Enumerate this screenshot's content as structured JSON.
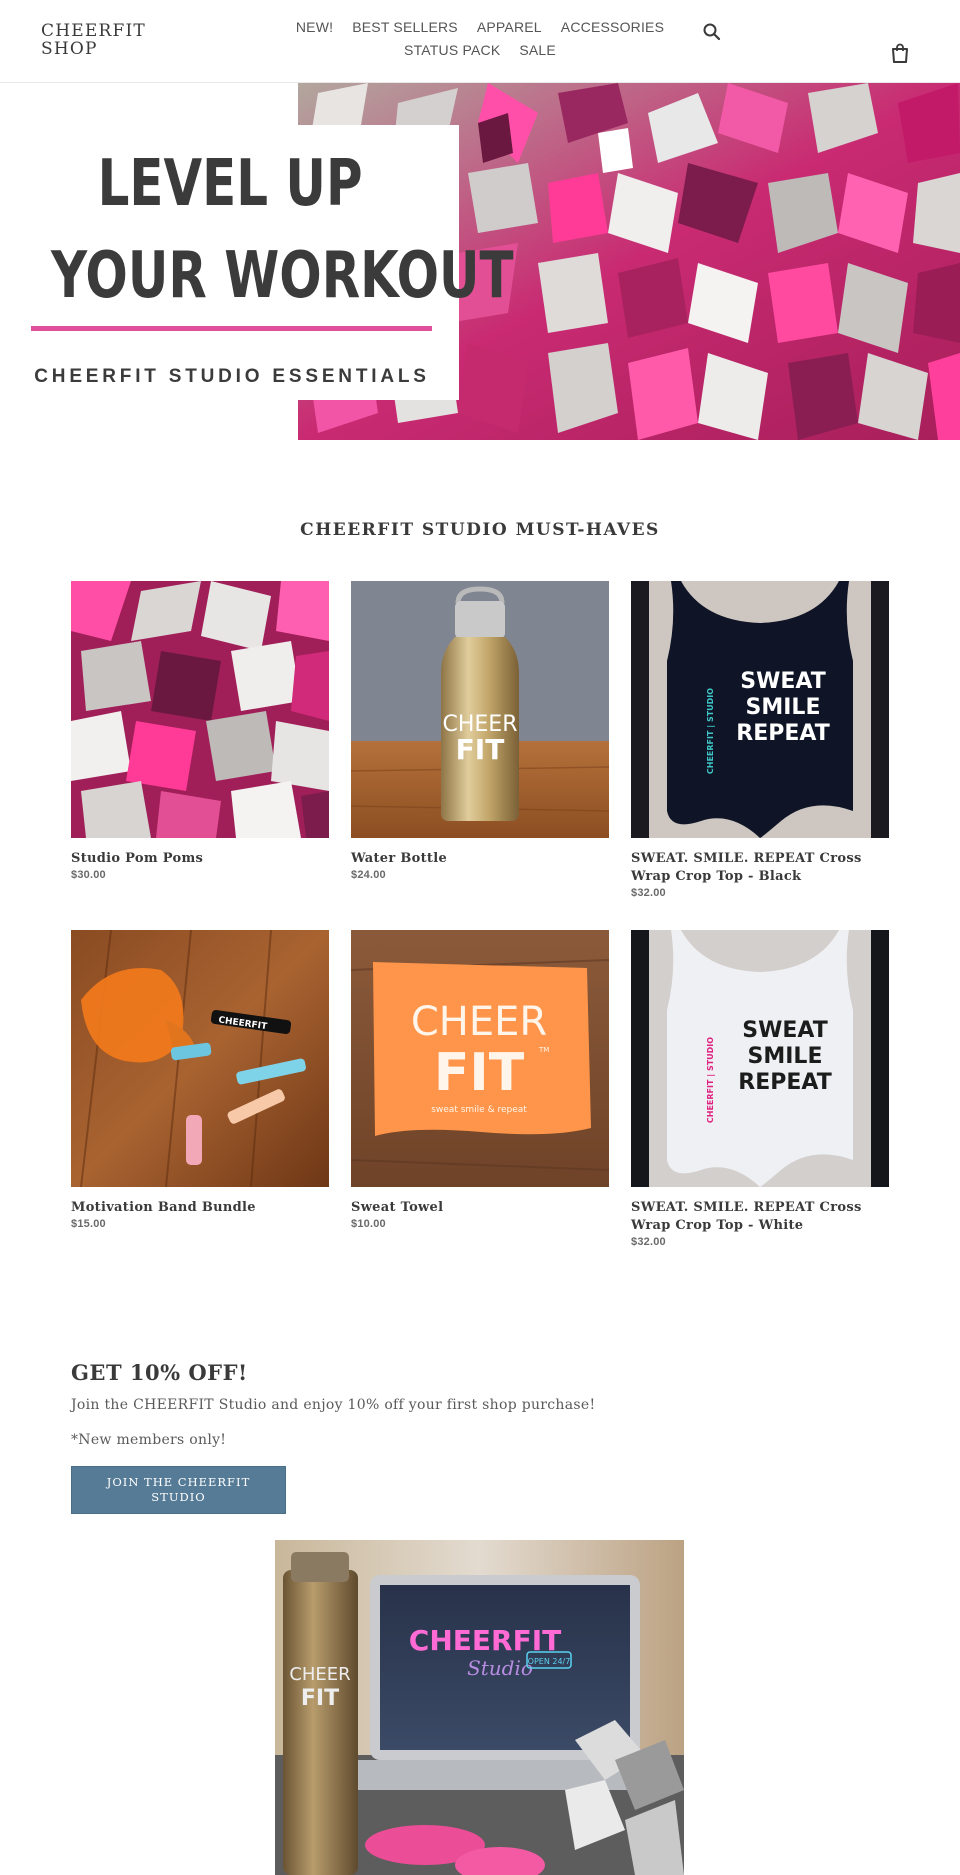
{
  "header": {
    "logo": "CHEERFIT SHOP",
    "nav": [
      "NEW!",
      "BEST SELLERS",
      "APPAREL",
      "ACCESSORIES",
      "STATUS PACK",
      "SALE"
    ],
    "search_icon": "search-icon",
    "cart_icon": "shopping-bag-icon"
  },
  "hero": {
    "title_line1": "LEVEL UP",
    "title_line2": "YOUR WORKOUT",
    "subtitle": "CHEERFIT STUDIO ESSENTIALS",
    "accent_color": "#df4f9a"
  },
  "collection": {
    "title": "CHEERFIT STUDIO MUST-HAVES",
    "products": [
      {
        "name": "Studio Pom Poms",
        "price": "$30.00"
      },
      {
        "name": "Water Bottle",
        "price": "$24.00"
      },
      {
        "name": "SWEAT. SMILE. REPEAT Cross Wrap Crop Top - Black",
        "price": "$32.00"
      },
      {
        "name": "Motivation Band Bundle",
        "price": "$15.00"
      },
      {
        "name": "Sweat Towel",
        "price": "$10.00"
      },
      {
        "name": "SWEAT. SMILE. REPEAT Cross Wrap Crop Top - White",
        "price": "$32.00"
      }
    ]
  },
  "promo": {
    "title": "GET 10% OFF!",
    "text": "Join the CHEERFIT Studio and enjoy 10% off your first shop purchase!",
    "note": "*New members only!",
    "button": "JOIN THE CHEERFIT STUDIO",
    "button_color": "#557b97"
  },
  "images": {
    "bottle_brand_top": "CHEER",
    "bottle_brand_bottom": "FIT",
    "shirt_text": [
      "SWEAT",
      "SMILE",
      "REPEAT"
    ],
    "shirt_side_text": "CHEERFIT | STUDIO",
    "towel_brand_top": "CHEER",
    "towel_brand_bottom": "FIT",
    "towel_tm": "TM",
    "towel_tagline": "sweat smile & repeat",
    "band_text": "CHEERFIT",
    "laptop_neon": "CHEERFIT",
    "laptop_script": "Studio",
    "laptop_sign": "OPEN 24/7"
  }
}
